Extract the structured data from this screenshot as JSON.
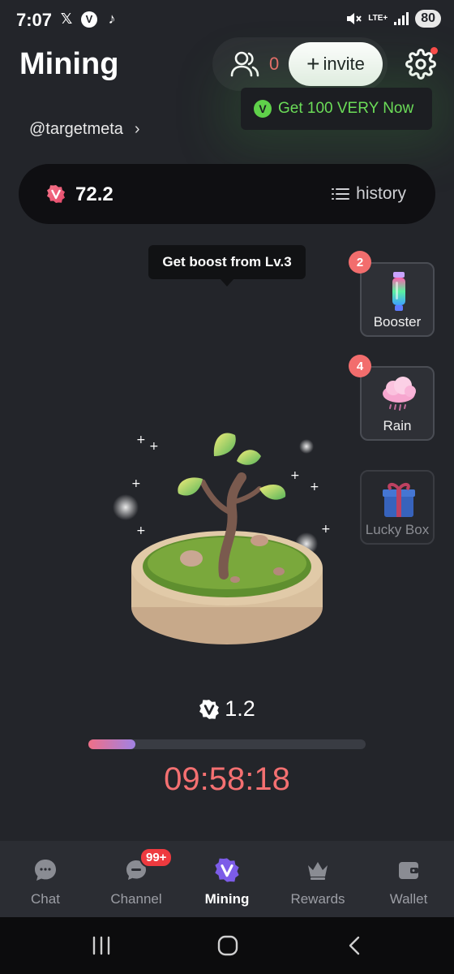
{
  "status_bar": {
    "time": "7:07",
    "left_icons": [
      "x-icon",
      "v-app-icon",
      "tiktok-icon"
    ],
    "network": "LTE+",
    "battery": "80"
  },
  "header": {
    "title": "Mining",
    "friends_count": "0",
    "invite_label": "invite",
    "promo_text": "Get 100 VERY Now",
    "username": "@targetmeta"
  },
  "balance": {
    "value": "72.2",
    "history_label": "history"
  },
  "tooltip": "Get boost from Lv.3",
  "side_cards": {
    "booster": {
      "label": "Booster",
      "badge": "2"
    },
    "rain": {
      "label": "Rain",
      "badge": "4"
    },
    "lucky_box": {
      "label": "Lucky Box"
    }
  },
  "mining": {
    "reward": "1.2",
    "progress_fraction": 0.17,
    "timer": "09:58:18"
  },
  "bottom_nav": {
    "items": [
      {
        "label": "Chat",
        "icon": "chat-bubble-icon"
      },
      {
        "label": "Channel",
        "icon": "channel-icon",
        "badge": "99+"
      },
      {
        "label": "Mining",
        "icon": "v-logo-icon",
        "active": true
      },
      {
        "label": "Rewards",
        "icon": "crown-icon"
      },
      {
        "label": "Wallet",
        "icon": "wallet-icon"
      }
    ]
  },
  "colors": {
    "accent_red": "#f47071",
    "promo_green": "#6bdc58",
    "active_purple": "#7c5ce8",
    "background": "#23252a"
  }
}
